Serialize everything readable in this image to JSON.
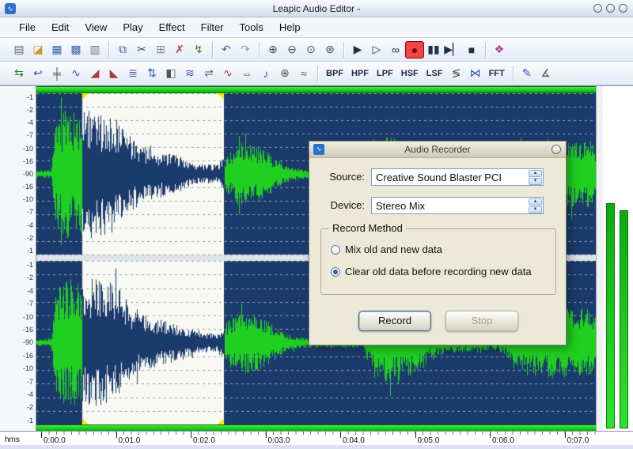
{
  "window": {
    "title": "Leapic Audio Editor -"
  },
  "icons": {
    "app_logo": "∿",
    "spin_up": "▲",
    "spin_down": "▼"
  },
  "menu": {
    "items": [
      "File",
      "Edit",
      "View",
      "Play",
      "Effect",
      "Filter",
      "Tools",
      "Help"
    ]
  },
  "toolbar_main": {
    "items": [
      {
        "name": "new-file",
        "glyph": "▤",
        "color": "#5a6d85"
      },
      {
        "name": "open-file",
        "glyph": "◪",
        "color": "#c59b2d"
      },
      {
        "name": "save-file",
        "glyph": "▦",
        "color": "#3f63a5"
      },
      {
        "name": "save-as",
        "glyph": "▩",
        "color": "#3f63a5"
      },
      {
        "name": "file-info",
        "glyph": "▥",
        "color": "#7a6a9a"
      },
      {
        "sep": true
      },
      {
        "name": "copy",
        "glyph": "⧉",
        "color": "#3f63a5"
      },
      {
        "name": "cut",
        "glyph": "✂",
        "color": "#444444"
      },
      {
        "name": "paste",
        "glyph": "⊞",
        "color": "#7a8aa0"
      },
      {
        "name": "delete",
        "glyph": "✗",
        "color": "#c23a3a"
      },
      {
        "name": "trim",
        "glyph": "↯",
        "color": "#2f7a2f"
      },
      {
        "sep": true
      },
      {
        "name": "undo",
        "glyph": "↶",
        "color": "#3a56b0"
      },
      {
        "name": "redo",
        "glyph": "↷",
        "color": "#8a96a8"
      },
      {
        "sep": true
      },
      {
        "name": "zoom-in",
        "glyph": "⊕",
        "color": "#33527e"
      },
      {
        "name": "zoom-out",
        "glyph": "⊖",
        "color": "#33527e"
      },
      {
        "name": "zoom-selection",
        "glyph": "⊙",
        "color": "#33527e"
      },
      {
        "name": "zoom-all",
        "glyph": "⊛",
        "color": "#33527e"
      },
      {
        "sep": true
      },
      {
        "name": "play",
        "glyph": "▶",
        "color": "#1c2f4e"
      },
      {
        "name": "play-all",
        "glyph": "▷",
        "color": "#1c2f4e"
      },
      {
        "name": "loop",
        "glyph": "∞",
        "color": "#1c2f4e"
      },
      {
        "name": "record",
        "glyph": "●",
        "color": "#7a0000",
        "style": "active"
      },
      {
        "name": "pause",
        "glyph": "▮▮",
        "color": "#1c2f4e"
      },
      {
        "name": "play-to-end",
        "glyph": "▶▏",
        "color": "#1c2f4e"
      },
      {
        "name": "stop",
        "glyph": "■",
        "color": "#1c2f4e"
      },
      {
        "sep": true
      },
      {
        "name": "help",
        "glyph": "❖",
        "color": "#b43a8a"
      }
    ]
  },
  "toolbar_effects": {
    "items": [
      {
        "name": "swap-channels",
        "glyph": "⇆",
        "color": "#2f7a2f"
      },
      {
        "name": "smooth",
        "glyph": "↩",
        "color": "#3a56b0"
      },
      {
        "name": "insert-silence",
        "glyph": "╪",
        "color": "#555555"
      },
      {
        "name": "amplify",
        "glyph": "∿",
        "color": "#3a56b0"
      },
      {
        "name": "fade-in",
        "glyph": "◢",
        "color": "#b03a3a"
      },
      {
        "name": "fade-out",
        "glyph": "◣",
        "color": "#b03a3a"
      },
      {
        "name": "normalize",
        "glyph": "≣",
        "color": "#3a56b0"
      },
      {
        "name": "invert",
        "glyph": "⇅",
        "color": "#3a56b0"
      },
      {
        "name": "pan",
        "glyph": "◧",
        "color": "#555555"
      },
      {
        "name": "echo",
        "glyph": "≋",
        "color": "#3a56b0"
      },
      {
        "name": "reverse",
        "glyph": "⇌",
        "color": "#555555"
      },
      {
        "name": "vibrato",
        "glyph": "∿",
        "color": "#b03a3a"
      },
      {
        "name": "stretch",
        "glyph": "⇔",
        "color": "#555555"
      },
      {
        "name": "pitch",
        "glyph": "♪",
        "color": "#3a56b0"
      },
      {
        "name": "mix-paste",
        "glyph": "⊕",
        "color": "#555555"
      },
      {
        "name": "chorus",
        "glyph": "≈",
        "color": "#b03a3a"
      },
      {
        "sep": true
      },
      {
        "name": "filter-bpf",
        "label": "BPF"
      },
      {
        "name": "filter-hpf",
        "label": "HPF"
      },
      {
        "name": "filter-lpf",
        "label": "LPF"
      },
      {
        "name": "filter-hsf",
        "label": "HSF"
      },
      {
        "name": "filter-lsf",
        "label": "LSF"
      },
      {
        "name": "equalizer",
        "glyph": "≶",
        "color": "#555555"
      },
      {
        "name": "notch-filter",
        "glyph": "⋈",
        "color": "#3a56b0"
      },
      {
        "name": "filter-fft",
        "label": "FFT"
      },
      {
        "sep": true
      },
      {
        "name": "edit-marker",
        "glyph": "✎",
        "color": "#3a56b0"
      },
      {
        "name": "spectrum-view",
        "glyph": "∡",
        "color": "#555555"
      }
    ]
  },
  "ruler": {
    "labels": [
      "-1",
      "-2",
      "-4",
      "-7",
      "-10",
      "-16",
      "-90",
      "-16",
      "-10",
      "-7",
      "-4",
      "-2",
      "-1"
    ]
  },
  "timeline": {
    "unit": "hms",
    "labels": [
      "0:00.0",
      "0:01.0",
      "0:02.0",
      "0:03.0",
      "0:04.0",
      "0:05.0",
      "0:06.0",
      "0:07.0"
    ]
  },
  "selection": {
    "start_s": 0.55,
    "end_s": 2.44
  },
  "meters": {
    "left_level": 0.67,
    "right_level": 0.65
  },
  "colors": {
    "wave_bg": "#1c3b6d",
    "wave_green": "#20d020",
    "selection_bg": "#f8f9f3",
    "selection_wave": "#1c3b6d",
    "grid": "#96a2b4"
  },
  "dialog": {
    "title": "Audio Recorder",
    "source_label": "Source:",
    "source_value": "Creative Sound Blaster PCI",
    "device_label": "Device:",
    "device_value": "Stereo Mix",
    "group_label": "Record Method",
    "options": [
      {
        "label": "Mix old and new data",
        "selected": false
      },
      {
        "label": "Clear old data before recording new data",
        "selected": true
      }
    ],
    "record_button": "Record",
    "stop_button": "Stop"
  }
}
